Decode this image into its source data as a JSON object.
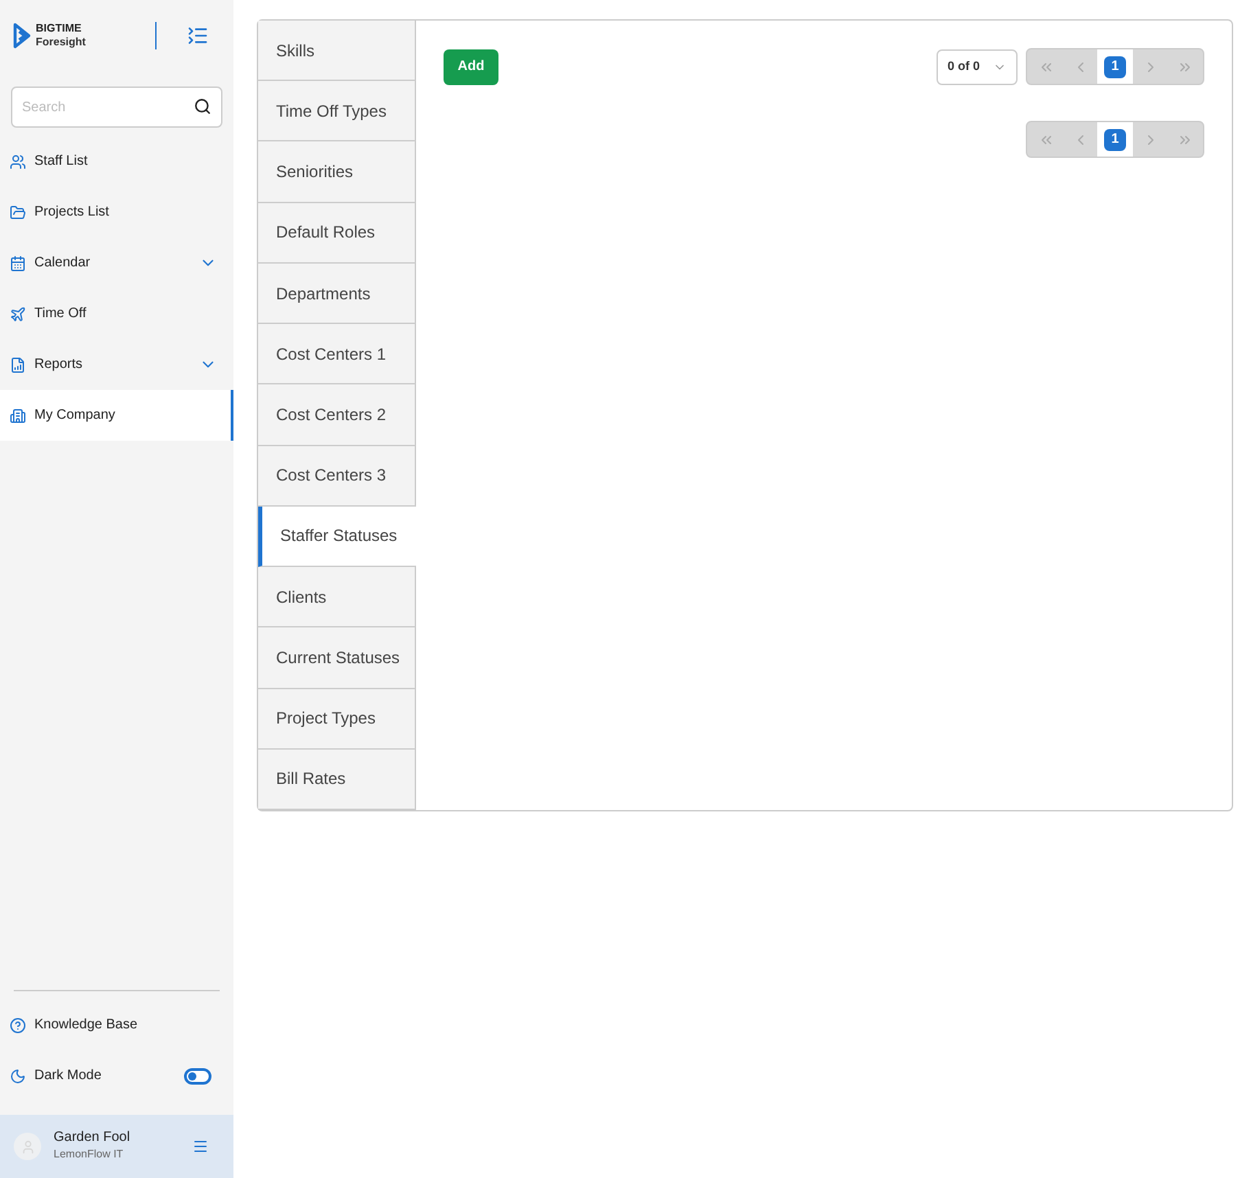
{
  "logo": {
    "line1": "BIGTIME",
    "line2": "Foresight"
  },
  "search": {
    "placeholder": "Search"
  },
  "nav": [
    {
      "label": "Staff List",
      "kind": "staff",
      "selected": false
    },
    {
      "label": "Projects List",
      "kind": "projects",
      "selected": false
    },
    {
      "label": "Calendar",
      "kind": "calendar",
      "selected": false,
      "expanded": false
    },
    {
      "label": "Time Off",
      "kind": "timeoff",
      "selected": false
    },
    {
      "label": "Reports",
      "kind": "reports",
      "selected": false,
      "expanded": false
    },
    {
      "label": "My Company",
      "kind": "company",
      "selected": true
    }
  ],
  "footer": {
    "knowledge_base": "Knowledge Base",
    "dark_mode": {
      "label": "Dark Mode",
      "on": false
    }
  },
  "user": {
    "name": "Garden Fool",
    "company": "LemonFlow IT"
  },
  "tabs": [
    {
      "label": "Skills",
      "selected": false
    },
    {
      "label": "Time Off Types",
      "selected": false
    },
    {
      "label": "Seniorities",
      "selected": false
    },
    {
      "label": "Default Roles",
      "selected": false
    },
    {
      "label": "Departments",
      "selected": false
    },
    {
      "label": "Cost Centers 1",
      "selected": false
    },
    {
      "label": "Cost Centers 2",
      "selected": false
    },
    {
      "label": "Cost Centers 3",
      "selected": false
    },
    {
      "label": "Staffer Statuses",
      "selected": true
    },
    {
      "label": "Clients",
      "selected": false
    },
    {
      "label": "Current Statuses",
      "selected": false
    },
    {
      "label": "Project Types",
      "selected": false
    },
    {
      "label": "Bill Rates",
      "selected": false
    }
  ],
  "add_button": "Add",
  "page_size": "0 of 0",
  "pager_top": {
    "pages": [
      {
        "label": "1",
        "selected": true
      }
    ]
  },
  "pager_bottom": {
    "pages": [
      {
        "label": "1",
        "selected": true
      }
    ]
  }
}
